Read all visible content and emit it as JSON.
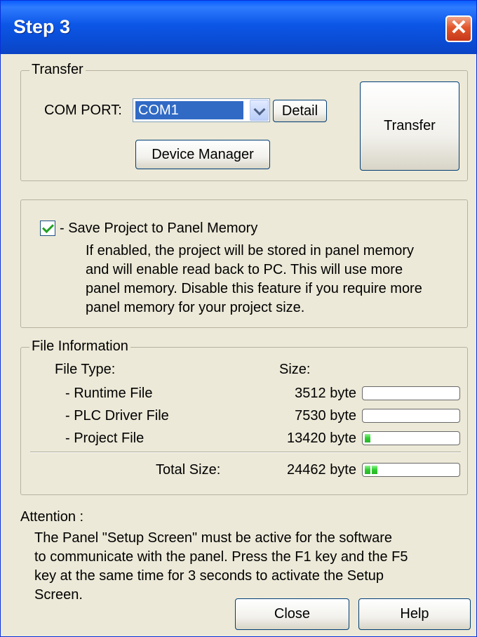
{
  "window": {
    "title": "Step 3",
    "close_glyph": "✕"
  },
  "transfer_group": {
    "label": "Transfer",
    "com_port_label": "COM PORT:",
    "com_port_value": "COM1",
    "detail_button": "Detail",
    "device_manager_button": "Device Manager",
    "transfer_button": "Transfer"
  },
  "save_group": {
    "checkbox_checked": true,
    "checkbox_label": "- Save Project to Panel Memory",
    "description": [
      "If enabled, the project will be stored in panel memory",
      "and will enable read back to PC. This will use more",
      "panel memory. Disable this feature if you require more",
      "panel memory for your project size."
    ]
  },
  "file_info": {
    "label": "File Information",
    "file_type_header": "File Type:",
    "size_header": "Size:",
    "rows": [
      {
        "name": "- Runtime File",
        "size": "3512 byte",
        "segments": 0
      },
      {
        "name": "- PLC Driver File",
        "size": "7530 byte",
        "segments": 0
      },
      {
        "name": "- Project File",
        "size": "13420 byte",
        "segments": 1
      }
    ],
    "total_label": "Total Size:",
    "total_size": "24462 byte",
    "total_segments": 2
  },
  "attention": {
    "label": "Attention :",
    "text": [
      "The Panel \"Setup Screen\" must be active for the software",
      "to communicate with the panel. Press the F1 key and the F5",
      "key at the same time for 3 seconds to activate the Setup",
      "Screen."
    ]
  },
  "footer": {
    "close_button": "Close",
    "help_button": "Help"
  },
  "colors": {
    "title_bar": "#0a4ed8",
    "window_bg": "#ece9d8",
    "selection": "#316ac5",
    "progress_green": "#2ecb2e",
    "close_red": "#e2562b"
  }
}
